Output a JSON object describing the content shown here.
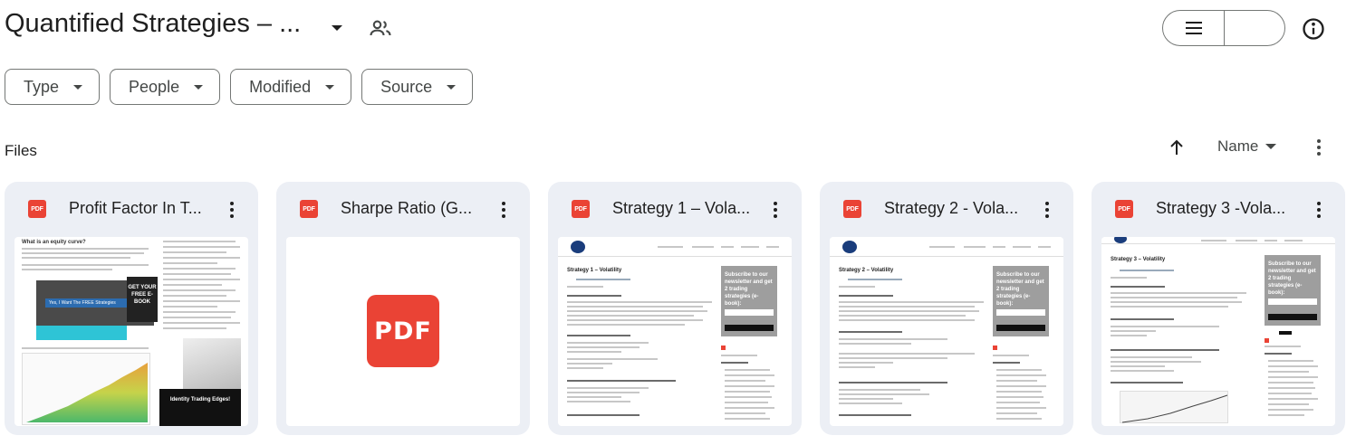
{
  "header": {
    "title": "Quantified Strategies – ...",
    "icons": {
      "caret": "chevron-down-icon",
      "shared": "people-icon",
      "list": "list-view-icon",
      "grid": "grid-view-icon",
      "info": "info-icon"
    }
  },
  "filters": [
    {
      "label": "Type"
    },
    {
      "label": "People"
    },
    {
      "label": "Modified"
    },
    {
      "label": "Source"
    }
  ],
  "files_section": {
    "label": "Files",
    "sort_label": "Name"
  },
  "files": [
    {
      "title": "Profit Factor In T...",
      "type_badge": "PDF",
      "thumbnail": "document-preview"
    },
    {
      "title": "Sharpe Ratio (G...",
      "type_badge": "PDF",
      "thumbnail": "pdf-icon"
    },
    {
      "title": "Strategy 1 – Vola...",
      "type_badge": "PDF",
      "thumbnail": "document-preview"
    },
    {
      "title": "Strategy 2 - Vola...",
      "type_badge": "PDF",
      "thumbnail": "document-preview"
    },
    {
      "title": "Strategy 3 -Vola...",
      "type_badge": "PDF",
      "thumbnail": "document-preview"
    }
  ],
  "thumb_text": {
    "big_pdf": "PDF",
    "pf_heading": "What is an equity curve?",
    "pf_banner": "Yes, I Want The FREE Strategies",
    "pf_book": "GET YOUR FREE E-BOOK",
    "pf_side_title": "Identity Trading Edges!",
    "s1_heading": "Strategy 1 – Volatility",
    "s2_heading": "Strategy 2 – Volatility",
    "s3_heading": "Strategy 3 – Volatility",
    "subscribe": "Subscribe to our newsletter and get 2 trading strategies (e-book):"
  },
  "colors": {
    "accent_toggle": "#c2e7ff",
    "pdf_red": "#ea4335",
    "card_bg": "#eceff5"
  }
}
